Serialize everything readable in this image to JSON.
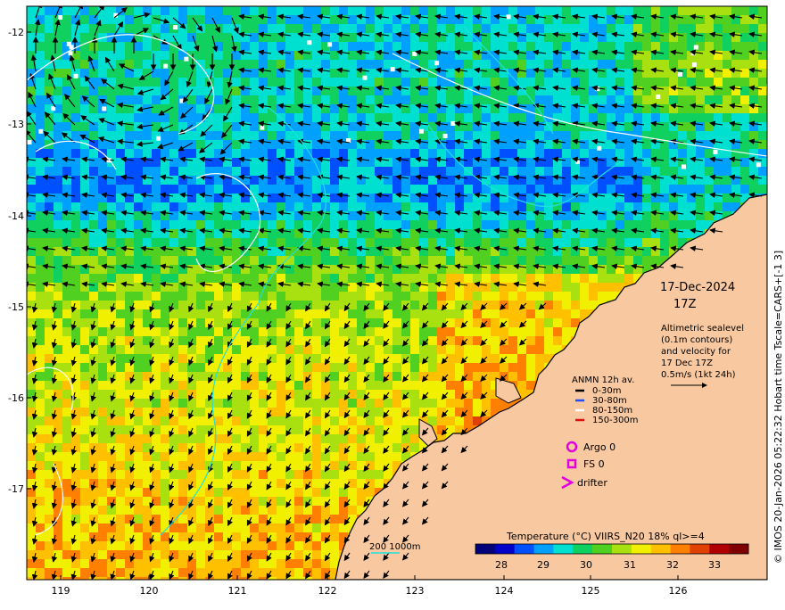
{
  "map": {
    "date": "17-Dec-2024",
    "time": "17Z",
    "lon_ticks": [
      "119",
      "120",
      "121",
      "122",
      "123",
      "124",
      "125",
      "126"
    ],
    "lat_ticks": [
      "-12",
      "-13",
      "-14",
      "-15",
      "-16",
      "-17"
    ],
    "side_label": "© IMOS 20-Jan-2026 05:22:32 Hobart time Tscale=CARS+[-1 3]",
    "altimetry_note": [
      "Altimetric sealevel",
      "(0.1m contours)",
      "and velocity for",
      "17 Dec 17Z",
      "0.5m/s (1kt 24h)"
    ],
    "depth_contours_label": "200  1000m"
  },
  "legend": {
    "title": "ANMN 12h av.",
    "items": [
      {
        "label": "0-30m",
        "color": "#000000"
      },
      {
        "label": "30-80m",
        "color": "#1f4fff"
      },
      {
        "label": "80-150m",
        "color": "#ffffff"
      },
      {
        "label": "150-300m",
        "color": "#e01010"
      }
    ],
    "markers": [
      {
        "label": "Argo 0",
        "color": "#e000e0",
        "shape": "circle"
      },
      {
        "label": "FS 0",
        "color": "#e000e0",
        "shape": "square"
      },
      {
        "label": "drifter",
        "color": "#e000e0",
        "shape": "chevron"
      }
    ]
  },
  "colorbar": {
    "title": "Temperature (°C) VIIRS_N20 18% ql>=4",
    "ticks": [
      "28",
      "29",
      "30",
      "31",
      "32",
      "33"
    ],
    "colors": [
      "#00007a",
      "#0000c8",
      "#0050ff",
      "#00a0ff",
      "#00e0d0",
      "#10d060",
      "#50d020",
      "#a8e010",
      "#f0f000",
      "#ffc000",
      "#ff8000",
      "#e04000",
      "#b00000",
      "#800000"
    ]
  },
  "colors": {
    "land": "#f8c8a0",
    "coast": "#000000",
    "contour": "#ffffff",
    "depth_contour": "#20e0e0"
  }
}
